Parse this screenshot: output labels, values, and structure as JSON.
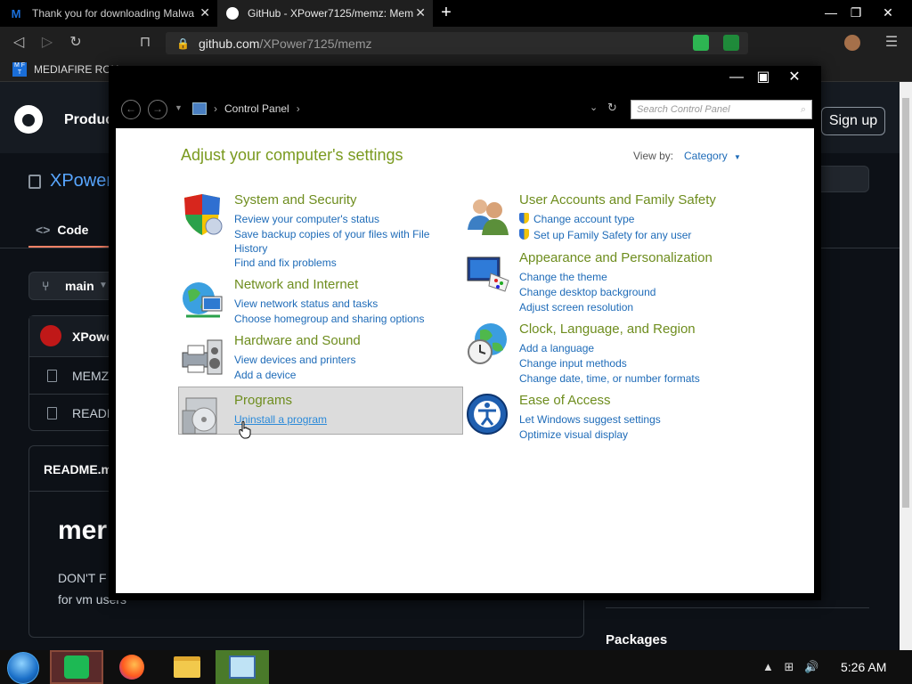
{
  "browser": {
    "tabs": [
      {
        "title": "Thank you for downloading Malwa",
        "favicon": "M"
      },
      {
        "title": "GitHub - XPower7125/memz: Mem",
        "favicon": "github"
      }
    ],
    "new_tab": "+",
    "url_host": "github.com",
    "url_path": "/XPower7125/memz",
    "bookmark": "MEDIAFIRE ROU"
  },
  "github": {
    "product": "Produc",
    "sign_in": "Sign up",
    "repo": "XPower",
    "code_tab": "Code",
    "branch": "main",
    "files": [
      "XPowe",
      "MEMZ",
      "READM"
    ],
    "readme_title": "README.m",
    "readme_h1": "mer",
    "readme_p1": "DON'T F",
    "readme_p2": "for vm users",
    "packages": "Packages"
  },
  "control_panel": {
    "breadcrumb": "Control Panel",
    "search_placeholder": "Search Control Panel",
    "heading": "Adjust your computer's settings",
    "view_by_label": "View by:",
    "view_by_value": "Category",
    "categories": [
      {
        "title": "System and Security",
        "icon": "shield-icon",
        "links": [
          "Review your computer's status",
          "Save backup copies of your files with File",
          "History",
          "Find and fix problems"
        ]
      },
      {
        "title": "Network and Internet",
        "icon": "globe-network-icon",
        "links": [
          "View network status and tasks",
          "Choose homegroup and sharing options"
        ]
      },
      {
        "title": "Hardware and Sound",
        "icon": "printer-speaker-icon",
        "links": [
          "View devices and printers",
          "Add a device"
        ]
      },
      {
        "title": "Programs",
        "icon": "programs-disc-icon",
        "links": [
          "Uninstall a program"
        ]
      },
      {
        "title": "User Accounts and Family Safety",
        "icon": "users-icon",
        "links": [
          "Change account type",
          "Set up Family Safety for any user"
        ]
      },
      {
        "title": "Appearance and Personalization",
        "icon": "monitor-palette-icon",
        "links": [
          "Change the theme",
          "Change desktop background",
          "Adjust screen resolution"
        ]
      },
      {
        "title": "Clock, Language, and Region",
        "icon": "clock-globe-icon",
        "links": [
          "Add a language",
          "Change input methods",
          "Change date, time, or number formats"
        ]
      },
      {
        "title": "Ease of Access",
        "icon": "ease-of-access-icon",
        "links": [
          "Let Windows suggest settings",
          "Optimize visual display"
        ]
      }
    ]
  },
  "taskbar": {
    "time": "5:26 AM"
  },
  "colors": {
    "cp_heading": "#7a9a1f",
    "cp_link": "#1e6bb8",
    "github_bg": "#0d1117"
  }
}
